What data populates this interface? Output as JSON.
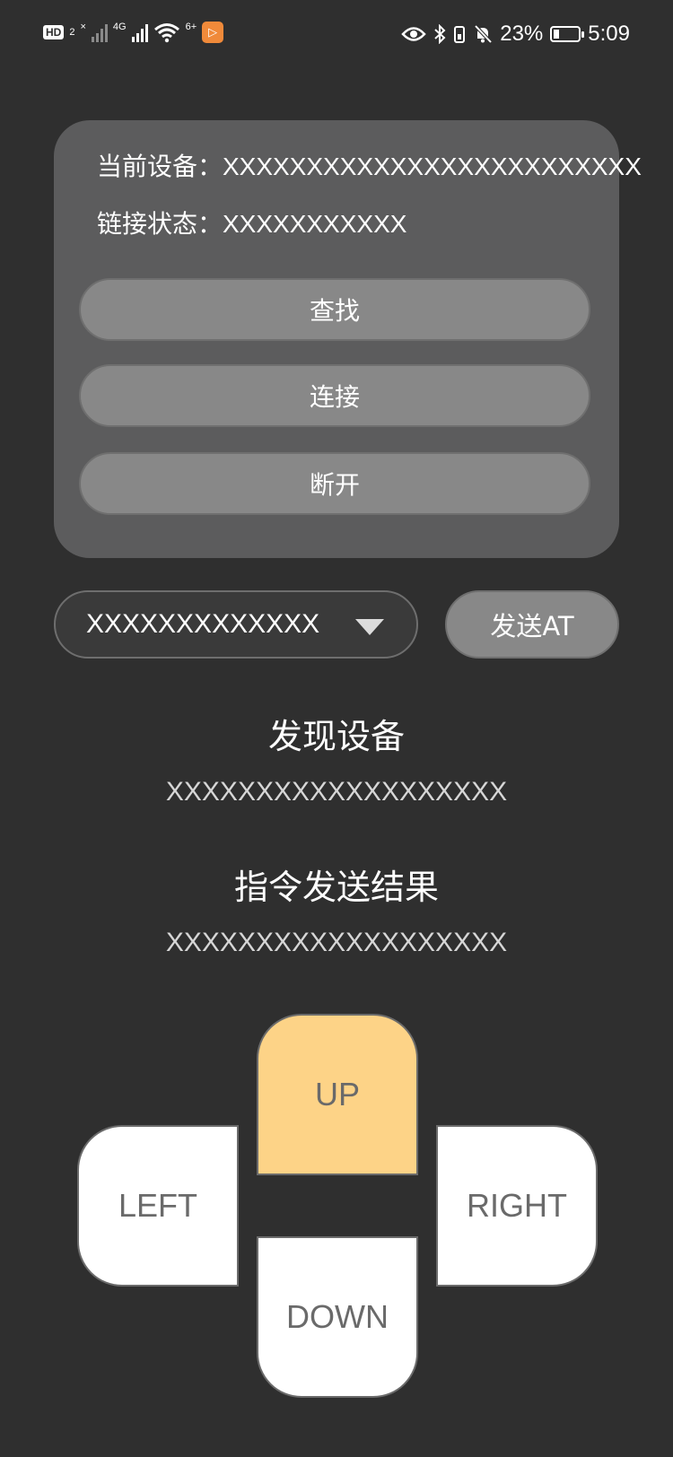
{
  "status_bar": {
    "hd_label": "HD",
    "sim2_label": "2",
    "nosignal_mark": "×",
    "network_type": "4G",
    "wifi_badge": "6+",
    "battery_percent": "23%",
    "time": "5:09",
    "battery_level": 0.23
  },
  "device_card": {
    "current_device": "当前设备：XXXXXXXXXXXXXXXXXXXXXXXXX",
    "link_status": "链接状态：XXXXXXXXXXX",
    "buttons": {
      "search": "查找",
      "connect": "连接",
      "disconnect": "断开"
    }
  },
  "at_command": {
    "selected": "XXXXXXXXXXXXX",
    "send_label": "发送AT"
  },
  "discovered": {
    "title": "发现设备",
    "value": "XXXXXXXXXXXXXXXXXXX"
  },
  "command_result": {
    "title": "指令发送结果",
    "value": "XXXXXXXXXXXXXXXXXXX"
  },
  "direction_pad": {
    "up": "UP",
    "left": "LEFT",
    "right": "RIGHT",
    "down": "DOWN",
    "active_color": "#fdd387",
    "idle_color": "#ffffff"
  },
  "colors": {
    "background": "#2f2f2f",
    "card": "#5c5c5d",
    "button": "#888888"
  }
}
